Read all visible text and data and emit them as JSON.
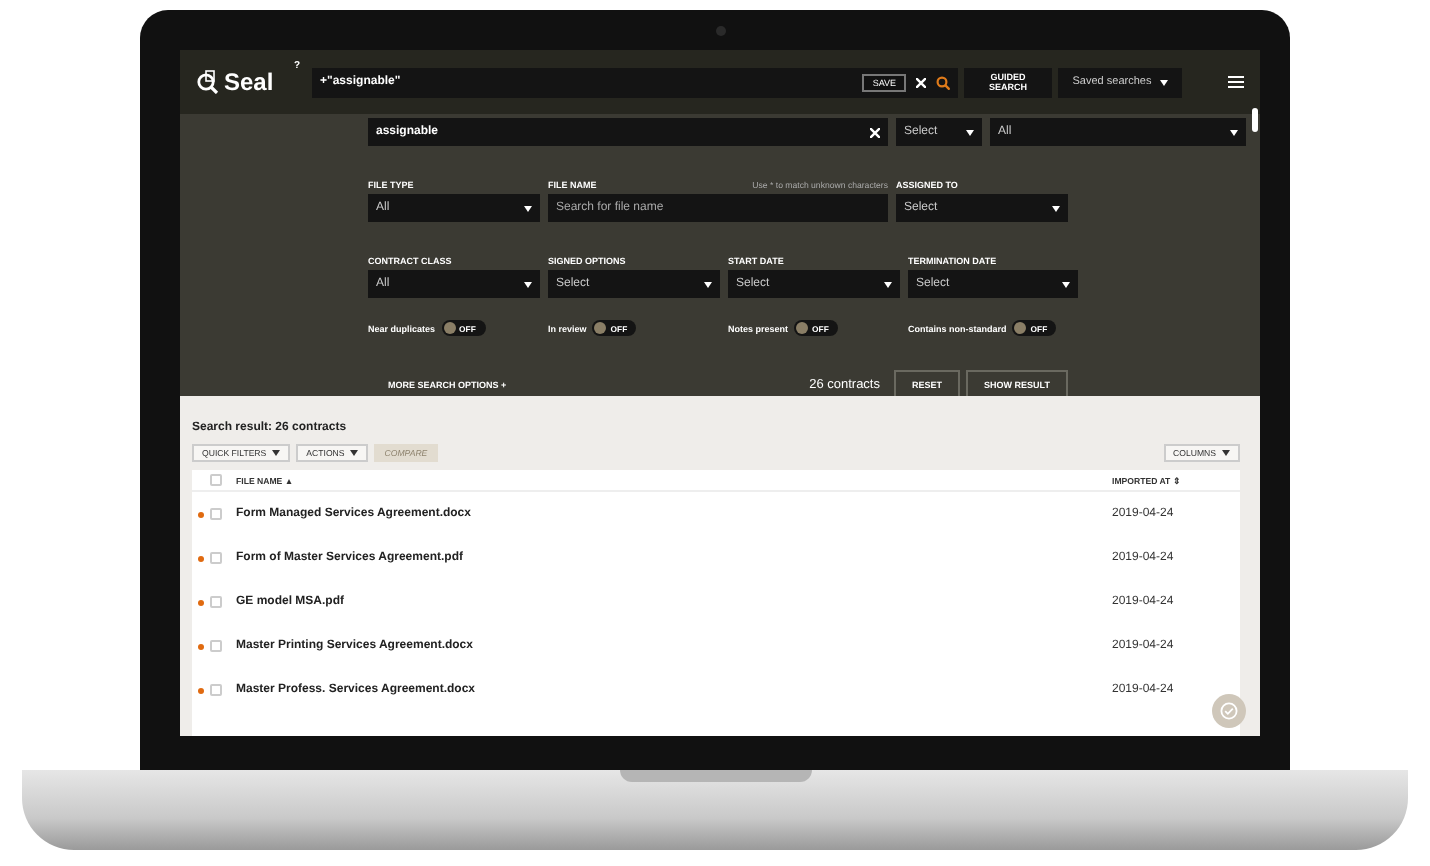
{
  "header": {
    "logo": "Seal",
    "help": "?",
    "search_value": "+\"assignable\"",
    "save": "SAVE",
    "guided_search": "GUIDED SEARCH",
    "saved_searches": "Saved searches"
  },
  "term_row": {
    "term": "assignable",
    "operator": "Select",
    "scope": "All"
  },
  "filters": [
    {
      "label": "FILE TYPE",
      "kind": "select",
      "value": "All"
    },
    {
      "label": "FILE NAME",
      "kind": "text",
      "placeholder": "Search for file name",
      "hint": "Use * to match unknown characters"
    },
    {
      "label": "ASSIGNED TO",
      "kind": "select",
      "value": "Select"
    },
    {
      "label": "CONTRACT CLASS",
      "kind": "select",
      "value": "All"
    },
    {
      "label": "SIGNED OPTIONS",
      "kind": "select",
      "value": "Select"
    },
    {
      "label": "START DATE",
      "kind": "select",
      "value": "Select"
    },
    {
      "label": "TERMINATION DATE",
      "kind": "select",
      "value": "Select"
    }
  ],
  "toggles": [
    {
      "label": "Near duplicates",
      "on": false,
      "text": "OFF"
    },
    {
      "label": "In review",
      "on": false,
      "text": "OFF"
    },
    {
      "label": "Notes present",
      "on": false,
      "text": "OFF"
    },
    {
      "label": "Contains non-standard",
      "on": false,
      "text": "OFF"
    }
  ],
  "more_options": "MORE SEARCH OPTIONS",
  "more_options_mark": "+",
  "count": "26 contracts",
  "reset": "RESET",
  "show_result": "SHOW RESULT",
  "results": {
    "title": "Search result: 26 contracts",
    "toolbar": [
      {
        "label": "QUICK FILTERS",
        "caret": true,
        "disabled": false
      },
      {
        "label": "ACTIONS",
        "caret": true,
        "disabled": false
      },
      {
        "label": "COMPARE",
        "caret": false,
        "disabled": true
      }
    ],
    "columns_button": "COLUMNS",
    "select_all_checked": false,
    "columns": [
      {
        "label": "FILE NAME",
        "sort": "▲"
      },
      {
        "label": "IMPORTED AT",
        "sort": "⇕"
      }
    ],
    "rows": [
      {
        "name": "Form Managed Services Agreement.docx",
        "date": "2019-04-24",
        "unread": true,
        "checked": false
      },
      {
        "name": "Form of Master Services Agreement.pdf",
        "date": "2019-04-24",
        "unread": true,
        "checked": false
      },
      {
        "name": "GE model MSA.pdf",
        "date": "2019-04-24",
        "unread": true,
        "checked": false
      },
      {
        "name": "Master Printing Services Agreement.docx",
        "date": "2019-04-24",
        "unread": true,
        "checked": false
      },
      {
        "name": "Master Profess. Services Agreement.docx",
        "date": "2019-04-24",
        "unread": true,
        "checked": false
      }
    ]
  }
}
